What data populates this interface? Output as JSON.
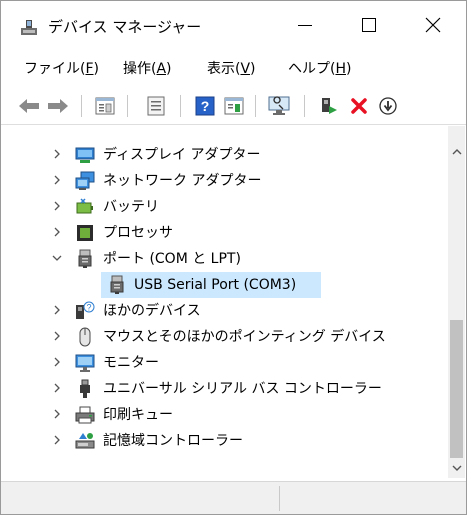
{
  "window": {
    "title": "デバイス マネージャー"
  },
  "menu": {
    "file": {
      "label": "ファイル(",
      "acc": "F",
      "end": ")"
    },
    "action": {
      "label": "操作(",
      "acc": "A",
      "end": ")"
    },
    "view": {
      "label": "表示(",
      "acc": "V",
      "end": ")"
    },
    "help": {
      "label": "ヘルプ(",
      "acc": "H",
      "end": ")"
    }
  },
  "toolbar": {
    "icons": [
      "back-arrow-icon",
      "forward-arrow-icon",
      "properties-icon",
      "print-icon",
      "help-icon",
      "update-driver-icon",
      "monitor-scan-icon",
      "enable-device-icon",
      "uninstall-icon",
      "disable-device-icon"
    ]
  },
  "tree": {
    "items": [
      {
        "label": "ディスプレイ アダプター",
        "icon": "display-adapter-icon",
        "expanded": false
      },
      {
        "label": "ネットワーク アダプター",
        "icon": "network-adapter-icon",
        "expanded": false
      },
      {
        "label": "バッテリ",
        "icon": "battery-icon",
        "expanded": false
      },
      {
        "label": "プロセッサ",
        "icon": "processor-icon",
        "expanded": false
      },
      {
        "label": "ポート (COM と LPT)",
        "icon": "port-icon",
        "expanded": true
      },
      {
        "label": "USB Serial Port (COM3)",
        "icon": "port-icon",
        "child": true,
        "selected": true
      },
      {
        "label": "ほかのデバイス",
        "icon": "unknown-device-icon",
        "expanded": false
      },
      {
        "label": "マウスとそのほかのポインティング デバイス",
        "icon": "mouse-icon",
        "expanded": false
      },
      {
        "label": "モニター",
        "icon": "monitor-icon",
        "expanded": false
      },
      {
        "label": "ユニバーサル シリアル バス コントローラー",
        "icon": "usb-icon",
        "expanded": false
      },
      {
        "label": "印刷キュー",
        "icon": "printer-icon",
        "expanded": false
      },
      {
        "label": "記憶域コントローラー",
        "icon": "storage-controller-icon",
        "expanded": false
      }
    ]
  },
  "colors": {
    "selection": "#cce8ff",
    "accent_red": "#e81123",
    "accent_green": "#2ea043",
    "accent_blue": "#1e6bd6"
  }
}
